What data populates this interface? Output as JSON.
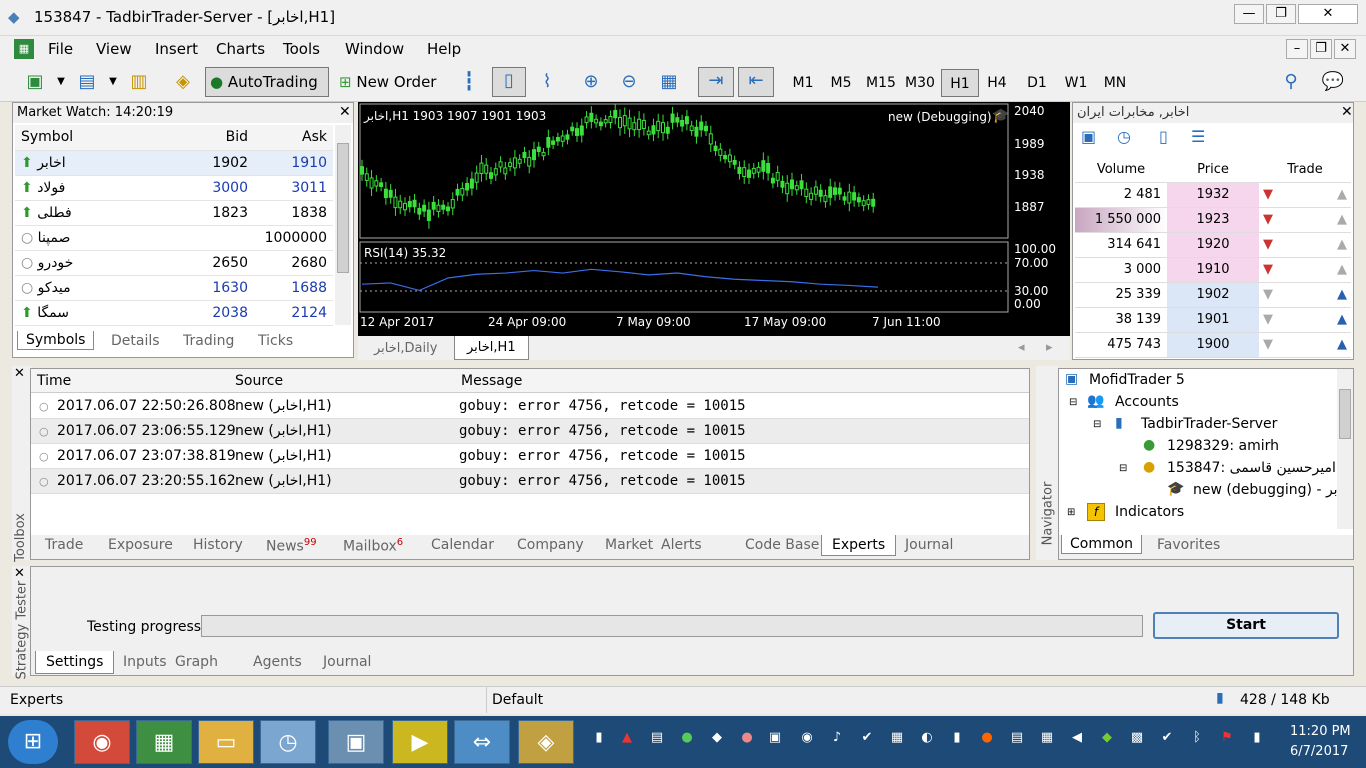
{
  "window": {
    "title": "153847 - TadbirTrader-Server - [اخابر,H1]"
  },
  "menu": [
    "File",
    "View",
    "Insert",
    "Charts",
    "Tools",
    "Window",
    "Help"
  ],
  "toolbar": {
    "autotrading": "AutoTrading",
    "new_order": "New Order",
    "timeframes": [
      "M1",
      "M5",
      "M15",
      "M30",
      "H1",
      "H4",
      "D1",
      "W1",
      "MN"
    ],
    "active_tf": "H1"
  },
  "market_watch": {
    "title": "Market Watch: 14:20:19",
    "headers": [
      "Symbol",
      "Bid",
      "Ask"
    ],
    "rows": [
      {
        "symbol": "اخابر",
        "bid": "1902",
        "ask": "1910",
        "dir": "up"
      },
      {
        "symbol": "فولاد",
        "bid": "3000",
        "ask": "3011",
        "dir": "up"
      },
      {
        "symbol": "فطلی",
        "bid": "1823",
        "ask": "1838",
        "dir": "up"
      },
      {
        "symbol": "صمپنا",
        "bid": "",
        "ask": "1000000",
        "dir": "none"
      },
      {
        "symbol": "خودرو",
        "bid": "2650",
        "ask": "2680",
        "dir": "none"
      },
      {
        "symbol": "میدکو",
        "bid": "1630",
        "ask": "1688",
        "dir": "none"
      },
      {
        "symbol": "سمگا",
        "bid": "2038",
        "ask": "2124",
        "dir": "up"
      }
    ],
    "tabs": [
      "Symbols",
      "Details",
      "Trading",
      "Ticks"
    ]
  },
  "chart": {
    "header": "اخابر,H1  1903 1907 1901 1903",
    "ea": "new (Debugging)",
    "price_labels": [
      "2040",
      "1989",
      "1938",
      "1887"
    ],
    "rsi_label": "RSI(14) 35.32",
    "rsi_levels": [
      "100.00",
      "70.00",
      "30.00",
      "0.00"
    ],
    "dates": [
      "12 Apr 2017",
      "24 Apr 09:00",
      "7 May 09:00",
      "17 May 09:00",
      "7 Jun 11:00"
    ],
    "tabs": [
      "اخابر,Daily",
      "اخابر,H1"
    ]
  },
  "chart_data": {
    "type": "line",
    "title": "",
    "ylim": [
      1860,
      2045
    ],
    "x": [
      "12 Apr 2017",
      "24 Apr 09:00",
      "7 May 09:00",
      "17 May 09:00",
      "7 Jun 11:00"
    ],
    "series": [
      {
        "name": "اخابر,H1",
        "values": [
          1955,
          1920,
          1895,
          1900,
          1948,
          1962,
          1975,
          2005,
          2028,
          2030,
          2010,
          2025,
          2010,
          1960,
          1955,
          1930,
          1920,
          1918,
          1903
        ]
      },
      {
        "name": "RSI(14)",
        "values": [
          40,
          42,
          30,
          50,
          56,
          58,
          62,
          58,
          64,
          60,
          55,
          58,
          52,
          48,
          46,
          44,
          40,
          38,
          35.32
        ]
      }
    ]
  },
  "dom": {
    "title": "اخابر, مخابرات ایران",
    "headers": [
      "Volume",
      "Price",
      "Trade"
    ],
    "rows": [
      {
        "volume": "2 481",
        "price": "1932",
        "side": "sell"
      },
      {
        "volume": "1 550 000",
        "price": "1923",
        "side": "sell"
      },
      {
        "volume": "314 641",
        "price": "1920",
        "side": "sell"
      },
      {
        "volume": "3 000",
        "price": "1910",
        "side": "sell"
      },
      {
        "volume": "25 339",
        "price": "1902",
        "side": "buy"
      },
      {
        "volume": "38 139",
        "price": "1901",
        "side": "buy"
      },
      {
        "volume": "475 743",
        "price": "1900",
        "side": "buy"
      }
    ]
  },
  "toolbox": {
    "label": "Toolbox",
    "headers": [
      "Time",
      "Source",
      "Message"
    ],
    "rows": [
      {
        "time": "2017.06.07 22:50:26.808",
        "source": "new (اخابر,H1)",
        "message": "gobuy: error 4756, retcode = 10015"
      },
      {
        "time": "2017.06.07 23:06:55.129",
        "source": "new (اخابر,H1)",
        "message": "gobuy: error 4756, retcode = 10015"
      },
      {
        "time": "2017.06.07 23:07:38.819",
        "source": "new (اخابر,H1)",
        "message": "gobuy: error 4756, retcode = 10015"
      },
      {
        "time": "2017.06.07 23:20:55.162",
        "source": "new (اخابر,H1)",
        "message": "gobuy: error 4756, retcode = 10015"
      }
    ],
    "tabs": [
      "Trade",
      "Exposure",
      "History",
      "News",
      "Mailbox",
      "Calendar",
      "Company",
      "Market",
      "Alerts",
      "Code Base",
      "Experts",
      "Journal"
    ],
    "news_count": "99",
    "mailbox_count": "6",
    "active_tab": "Experts"
  },
  "navigator": {
    "label": "Navigator",
    "root": "MofidTrader 5",
    "accounts": "Accounts",
    "server": "TadbirTrader-Server",
    "acc1": "1298329: amirh",
    "acc2": "امیرحسین قاسمی :153847",
    "ea": "new (debugging) - بر",
    "indicators": "Indicators",
    "tabs": [
      "Common",
      "Favorites"
    ]
  },
  "tester": {
    "label": "Strategy Tester",
    "progress_label": "Testing progress:",
    "progress": 0,
    "start": "Start",
    "tabs": [
      "Settings",
      "Inputs",
      "Graph",
      "Agents",
      "Journal"
    ]
  },
  "status": {
    "left": "Experts",
    "mid": "Default",
    "right": "428 / 148 Kb"
  },
  "taskbar": {
    "time": "11:20 PM",
    "date": "6/7/2017"
  }
}
